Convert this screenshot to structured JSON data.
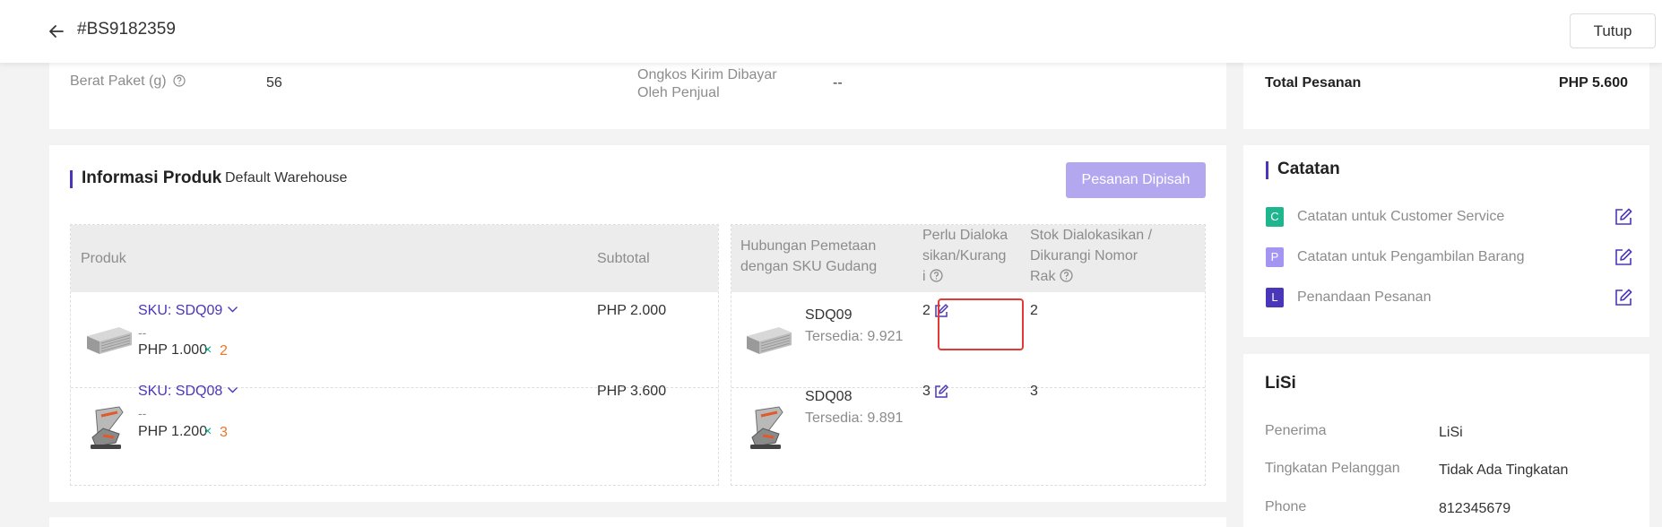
{
  "header": {
    "order_id": "#BS9182359",
    "close_label": "Tutup"
  },
  "package": {
    "weight_label": "Berat Paket (g)",
    "weight_value": "56",
    "shipping_label": "Ongkos Kirim Dibayar Oleh Penjual",
    "shipping_value": "--"
  },
  "product_info": {
    "title": "Informasi Produk",
    "warehouse": "Default Warehouse",
    "split_button": "Pesanan Dipisah",
    "left_headers": {
      "product": "Produk",
      "subtotal": "Subtotal"
    },
    "right_headers": {
      "mapping": "Hubungan Pemetaan dengan SKU Gudang",
      "allocate": "Perlu Dialokasikan/Kurangi",
      "stock": "Stok Dialokasikan / Dikurangi Nomor Rak"
    },
    "rows": [
      {
        "sku_link": "SKU: SDQ09",
        "variant": "--",
        "unit_price": "PHP 1.000",
        "times": "×",
        "qty": "2",
        "subtotal": "PHP 2.000",
        "warehouse_sku": "SDQ09",
        "available": "Tersedia: 9.921",
        "allocate": "2",
        "stock": "2"
      },
      {
        "sku_link": "SKU: SDQ08",
        "variant": "--",
        "unit_price": "PHP 1.200",
        "times": "×",
        "qty": "3",
        "subtotal": "PHP 3.600",
        "warehouse_sku": "SDQ08",
        "available": "Tersedia: 9.891",
        "allocate": "3",
        "stock": "3"
      }
    ]
  },
  "totals": {
    "label": "Total Pesanan",
    "value": "PHP 5.600"
  },
  "notes": {
    "title": "Catatan",
    "items": [
      {
        "badge": "C",
        "label": "Catatan untuk Customer Service",
        "color": "#1fb58f"
      },
      {
        "badge": "P",
        "label": "Catatan untuk Pengambilan Barang",
        "color": "#a595f2"
      },
      {
        "badge": "L",
        "label": "Penandaan Pesanan",
        "color": "#4a36b8"
      }
    ]
  },
  "customer": {
    "name": "LiSi",
    "fields": [
      {
        "label": "Penerima",
        "value": "LiSi"
      },
      {
        "label": "Tingkatan Pelanggan",
        "value": "Tidak Ada Tingkatan"
      },
      {
        "label": "Phone",
        "value": "812345679"
      }
    ]
  },
  "colors": {
    "accent": "#4a36b8",
    "highlight_box": "#e53935",
    "qty": "#e8772a",
    "times": "#13a88a"
  }
}
